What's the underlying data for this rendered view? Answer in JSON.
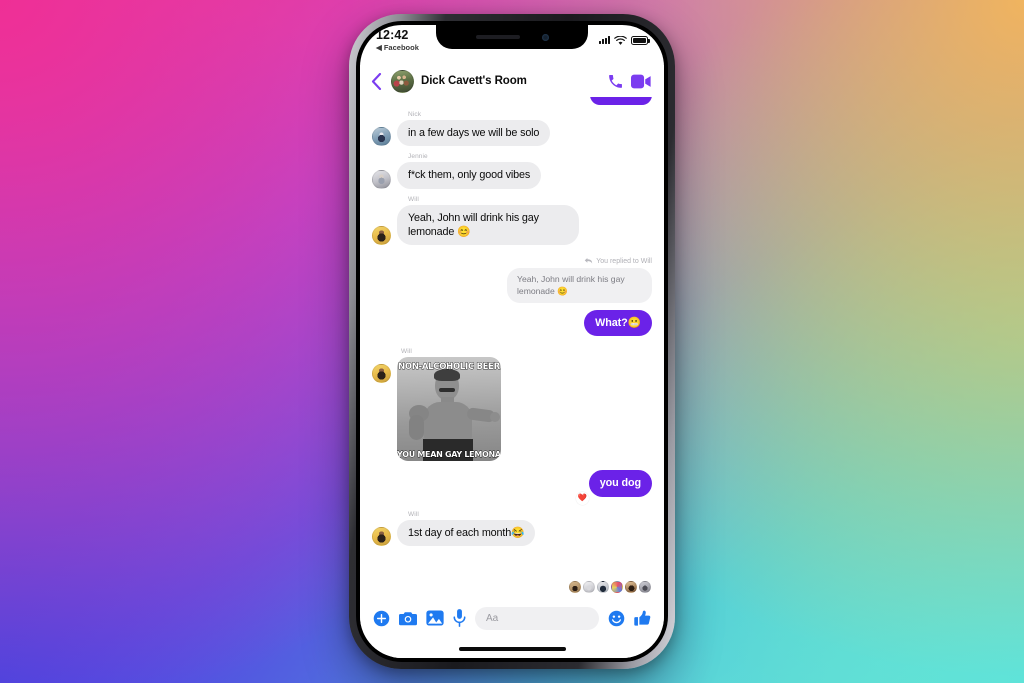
{
  "background": {
    "colors": [
      "#ef2f96",
      "#f0b45f",
      "#b955ea",
      "#4a44e0",
      "#5fe3d9"
    ]
  },
  "device": {
    "frame": "iphone-x",
    "home_indicator": true
  },
  "status_bar": {
    "time": "12:42",
    "back_app_label": "Facebook",
    "back_app_arrow": "◀",
    "icons": [
      "signal-bars",
      "wifi",
      "battery"
    ]
  },
  "chat_header": {
    "back_label": "back",
    "title": "Dick Cavett's Room",
    "avatar": "group-photo-avatar",
    "actions": [
      "audio-call",
      "video-call"
    ],
    "accent_color": "#7b3cf0"
  },
  "conversation": {
    "peek_bubble": "",
    "messages": [
      {
        "id": "m1",
        "direction": "in",
        "sender": "Nick",
        "avatar": "nick",
        "text": "in a few days we will be solo"
      },
      {
        "id": "m2",
        "direction": "in",
        "sender": "Jennie",
        "avatar": "jennie",
        "text": "f*ck them, only good vibes"
      },
      {
        "id": "m3",
        "direction": "in",
        "sender": "Will",
        "avatar": "will",
        "text": "Yeah, John will drink his gay lemonade 😊"
      },
      {
        "id": "m4",
        "direction": "out",
        "reply_label": "You replied to Will",
        "quoted_text": "Yeah, John will drink his gay lemonade 😊",
        "text": "What?😬"
      },
      {
        "id": "m5",
        "direction": "in",
        "sender": "Will",
        "avatar": "will",
        "type": "image",
        "meme": {
          "name": "overly-manly-man",
          "top_text": "NON-ALCOHOLIC BEER",
          "bottom_text": "YOU MEAN GAY LEMONADE?"
        }
      },
      {
        "id": "m6",
        "direction": "out",
        "text": "you dog",
        "reaction": "❤️"
      },
      {
        "id": "m7",
        "direction": "in",
        "sender": "Will",
        "avatar": "will",
        "text": "1st day of each month😂"
      }
    ],
    "bubble_colors": {
      "incoming": "#ececee",
      "outgoing": "#6b22e8",
      "quoted": "#f0f0f2"
    }
  },
  "seen_by": {
    "count": 6,
    "label": "seen-by-avatars"
  },
  "input_bar": {
    "actions": [
      "add",
      "camera",
      "gallery",
      "microphone"
    ],
    "placeholder": "Aa",
    "emoji_button": "emoji",
    "like_button": "thumbs-up",
    "icon_color": "#1f7af0"
  }
}
